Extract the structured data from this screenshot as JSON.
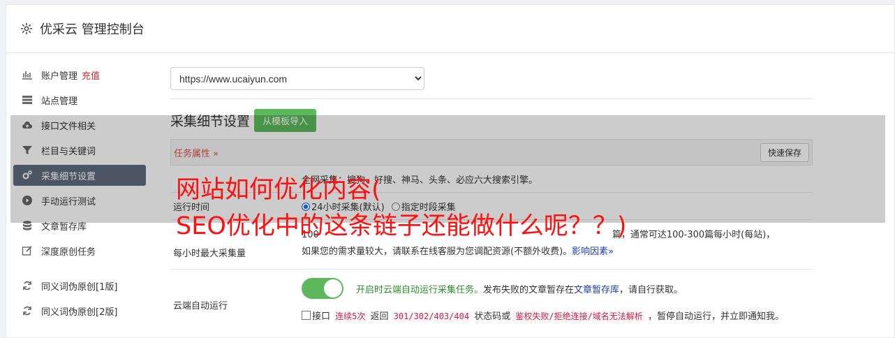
{
  "header": {
    "title": "优采云 管理控制台"
  },
  "sidebar": {
    "items": [
      {
        "label": "账户管理",
        "badge": "充值",
        "icon": "bar-chart-icon"
      },
      {
        "label": "站点管理",
        "icon": "server-icon"
      },
      {
        "label": "接口文件相关",
        "icon": "cloud-upload-icon"
      },
      {
        "label": "栏目与关键词",
        "icon": "filter-icon"
      },
      {
        "label": "采集细节设置",
        "icon": "gears-icon",
        "active": true
      },
      {
        "label": "手动运行测试",
        "icon": "play-circle-icon"
      },
      {
        "label": "文章暂存库",
        "icon": "database-icon"
      },
      {
        "label": "深度原创任务",
        "icon": "edit-icon"
      },
      {
        "label": "同义词伪原创[1版]",
        "icon": "refresh-icon"
      },
      {
        "label": "同义词伪原创[2版]",
        "icon": "refresh-icon"
      }
    ]
  },
  "main": {
    "site_select": "https://www.ucaiyun.com",
    "section_title": "采集细节设置",
    "import_button": "从模板导入",
    "task_attr": "任务属性",
    "quick_save": "快速保存",
    "row_engines_text": "全网采集：搜狗、好搜、神马、头条、必应六大搜索引擎。",
    "run_time": {
      "label": "运行时间",
      "opt1": "24小时采集(默认)",
      "opt2": "指定时段采集"
    },
    "max_collect": {
      "label": "每小时最大采集量",
      "line1_a": "100",
      "line1_b": "篇，通常可达100-300篇每小时(每站)，",
      "line2": "如果您的需求量较大，请联系在线客服为您调配资源(不额外收费)。",
      "link": "影响因素"
    },
    "cloud_run": {
      "label": "云端自动运行",
      "green_text": "开启时云端自动运行采集任务。",
      "text2": "发布失败的文章暂存在",
      "link": "文章暂存库",
      "text3": "，请自行获取。",
      "cb_label": "接口",
      "code1": "连续5次",
      "text4": "返回",
      "code2": "301/302/403/404",
      "text5": "状态码或",
      "code3": "鉴权失败/拒绝连接/域名无法解析",
      "text6": "，暂停自动运行，并立即通知我。"
    }
  },
  "overlay": {
    "line1": "网站如何优化内容(",
    "line2": "SEO优化中的这条链子还能做什么呢？？)"
  }
}
